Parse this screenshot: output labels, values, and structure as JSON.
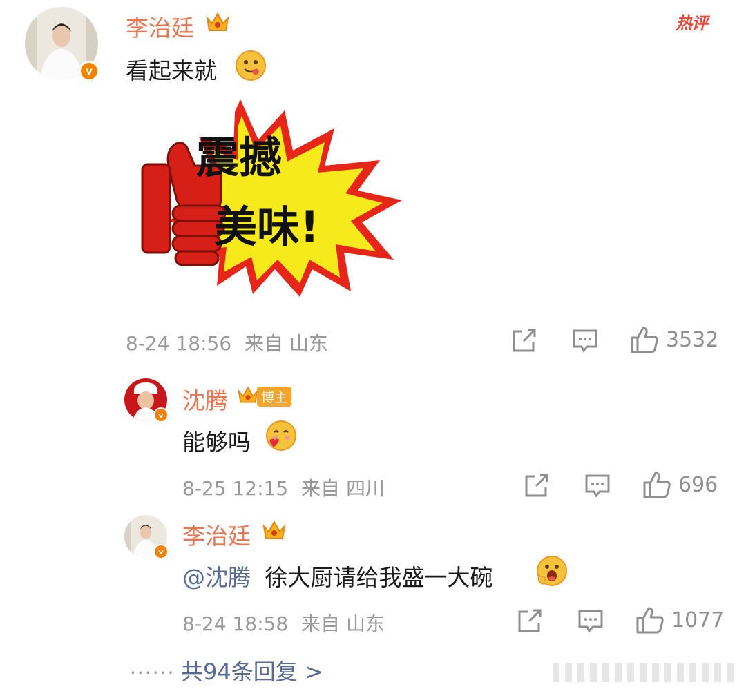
{
  "hot_label": "热评",
  "main_comment": {
    "username": "李治廷",
    "text": "看起来就",
    "sticker_text_line1": "震撼",
    "sticker_text_line2": "美味!",
    "time": "8-24 18:56",
    "source": "来自 山东",
    "likes": "3532"
  },
  "reply1": {
    "username": "沈腾",
    "badge": "博主",
    "text": "能够吗",
    "time": "8-25 12:15",
    "source": "来自 四川",
    "likes": "696"
  },
  "reply2": {
    "username": "李治廷",
    "mention": "@沈腾",
    "text": "徐大厨请给我盛一大碗",
    "time": "8-24 18:58",
    "source": "来自 山东",
    "likes": "1077"
  },
  "footer": {
    "dots": "......",
    "replies_label": "共94条回复 >"
  },
  "colors": {
    "username": "#eb7350",
    "mention": "#576b95",
    "meta": "#999999",
    "crown": "#f2a20c",
    "badge": "#f08200"
  },
  "icons": [
    "crown-icon",
    "verified-icon",
    "repost-icon",
    "comment-icon",
    "like-icon",
    "emoji-icon"
  ]
}
